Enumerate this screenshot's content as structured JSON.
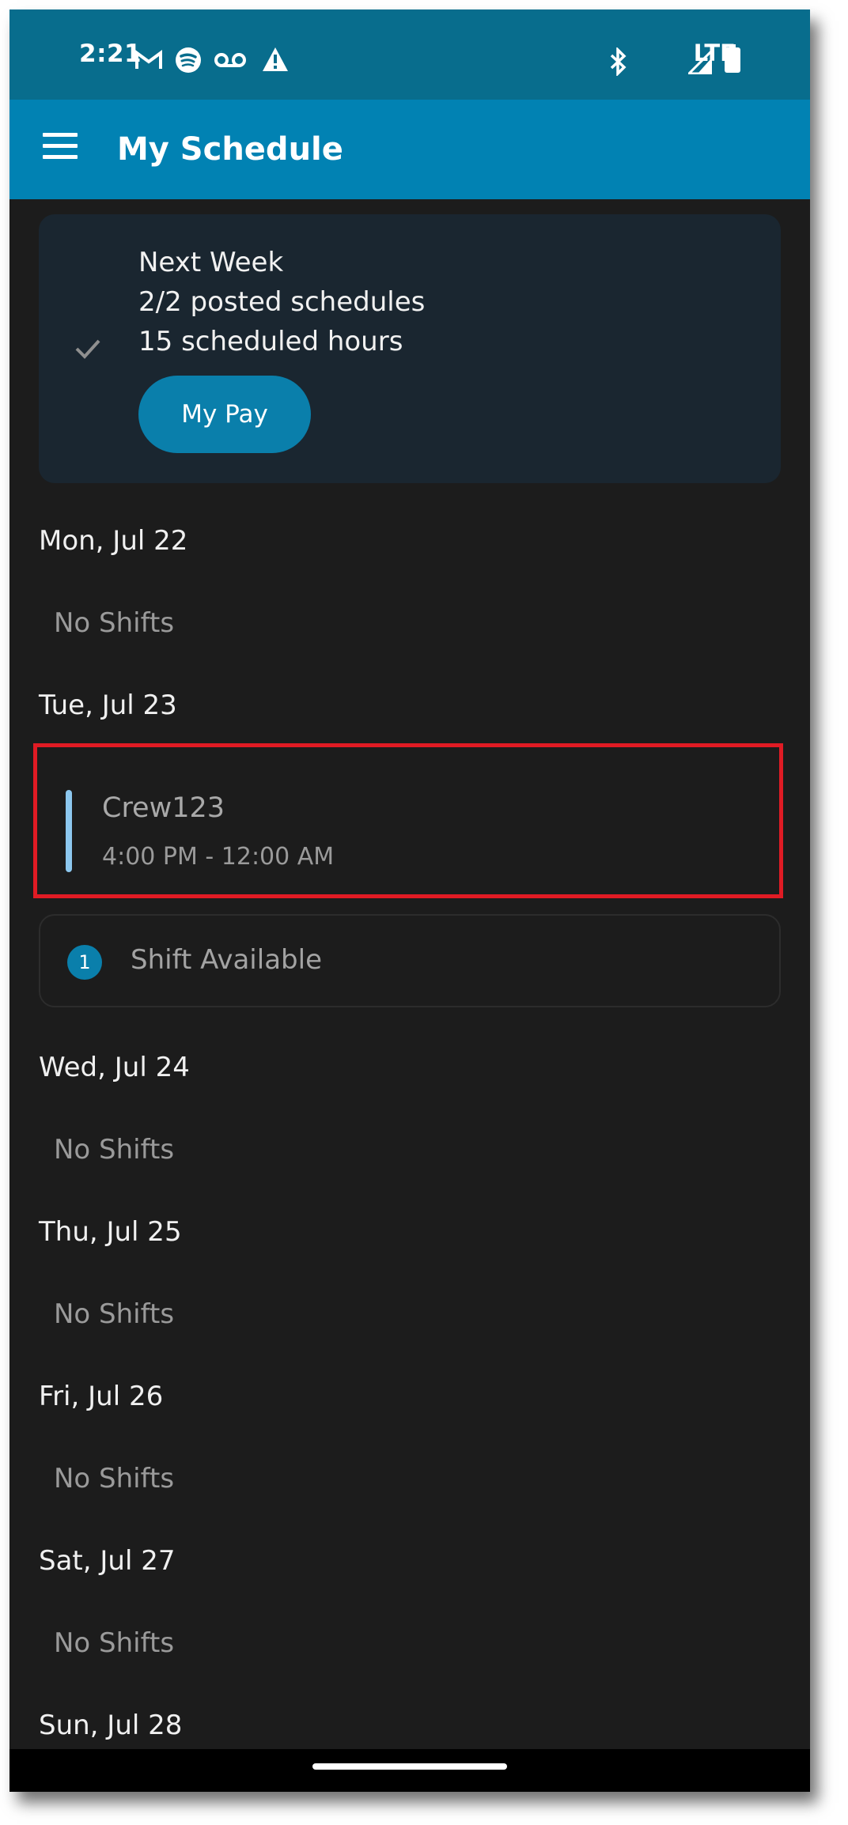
{
  "status_bar": {
    "time": "2:21",
    "left_icons": [
      "gmail-icon",
      "spotify-icon",
      "voicemail-icon",
      "warning-icon"
    ],
    "network": "LTE",
    "right_icons": [
      "bluetooth-icon",
      "signal-icon",
      "battery-icon"
    ]
  },
  "app_bar": {
    "title": "My Schedule",
    "menu_icon": "menu-icon"
  },
  "summary": {
    "title": "Next Week",
    "posted": "2/2 posted schedules",
    "hours": "15 scheduled hours",
    "button_label": "My Pay",
    "icon": "check-icon"
  },
  "days": [
    {
      "label": "Mon, Jul 22",
      "empty_text": "No Shifts"
    },
    {
      "label": "Tue, Jul 23"
    },
    {
      "label": "Wed, Jul 24",
      "empty_text": "No Shifts"
    },
    {
      "label": "Thu, Jul 25",
      "empty_text": "No Shifts"
    },
    {
      "label": "Fri, Jul 26",
      "empty_text": "No Shifts"
    },
    {
      "label": "Sat, Jul 27",
      "empty_text": "No Shifts"
    },
    {
      "label": "Sun, Jul 28"
    }
  ],
  "shift": {
    "name": "Crew123",
    "time": "4:00 PM - 12:00 AM"
  },
  "available": {
    "count": "1",
    "label": "Shift Available"
  },
  "colors": {
    "status_bar": "#086d8d",
    "app_bar": "#0182b3",
    "background": "#1c1c1c",
    "card": "#1a2630",
    "accent": "#0a7fab",
    "highlight": "#e01b24"
  }
}
